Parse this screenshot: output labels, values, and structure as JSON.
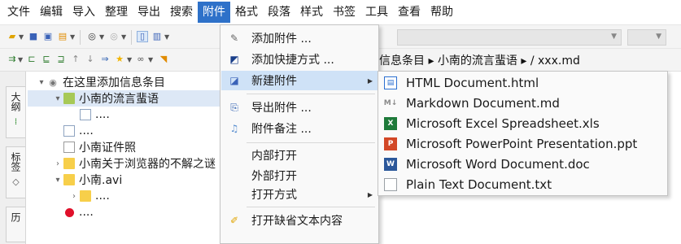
{
  "menubar": {
    "items": [
      "文件",
      "编辑",
      "导入",
      "整理",
      "导出",
      "搜索",
      "附件",
      "格式",
      "段落",
      "样式",
      "书签",
      "工具",
      "查看",
      "帮助"
    ],
    "active_index": 6
  },
  "breadcrumb": {
    "text": "信息条目  ▸  小南的流言蜚语  ▸  / xxx.md"
  },
  "side_tabs": [
    {
      "label": "大纲",
      "icon": "outline-icon"
    },
    {
      "label": "标签",
      "icon": "tag-icon"
    },
    {
      "label": "历",
      "icon": "history-icon"
    }
  ],
  "tree": {
    "rows": [
      {
        "indent": 0,
        "chevron": "▾",
        "icon": "eye-icon",
        "label": "在这里添加信息条目",
        "selected": false
      },
      {
        "indent": 1,
        "chevron": "▾",
        "icon": "folder-green-icon",
        "label": "小南的流言蜚语",
        "selected": true
      },
      {
        "indent": 2,
        "chevron": "",
        "icon": "doc-icon",
        "label": "....",
        "selected": false
      },
      {
        "indent": 1,
        "chevron": "",
        "icon": "doc-icon",
        "label": "....",
        "selected": false
      },
      {
        "indent": 1,
        "chevron": "",
        "icon": "doc-grey-icon",
        "label": "小南证件照",
        "selected": false
      },
      {
        "indent": 1,
        "chevron": "›",
        "icon": "folder-icon",
        "label": "小南关于浏览器的不解之谜",
        "selected": false
      },
      {
        "indent": 1,
        "chevron": "▾",
        "icon": "folder-icon",
        "label": "小南.avi",
        "selected": false
      },
      {
        "indent": 2,
        "chevron": "›",
        "icon": "folder-icon",
        "label": "....",
        "selected": false
      },
      {
        "indent": 1,
        "chevron": "",
        "icon": "red-bug-icon",
        "label": "....",
        "selected": false
      }
    ]
  },
  "attachment_menu": {
    "items": [
      {
        "icon": "paperclip-icon",
        "label": "添加附件 ...",
        "submenu": false
      },
      {
        "icon": "shortcut-icon",
        "label": "添加快捷方式 ...",
        "submenu": false
      },
      {
        "icon": "new-file-icon",
        "label": "新建附件",
        "submenu": true,
        "highlighted": true
      },
      {
        "icon": "export-icon",
        "label": "导出附件 ...",
        "submenu": false
      },
      {
        "icon": "note-icon",
        "label": "附件备注 ...",
        "submenu": false
      },
      {
        "icon": "",
        "label": "内部打开",
        "submenu": false
      },
      {
        "icon": "",
        "label": "外部打开",
        "submenu": false
      },
      {
        "icon": "",
        "label": "打开方式",
        "submenu": true
      },
      {
        "icon": "pencil-icon",
        "label": "打开缺省文本内容",
        "submenu": false
      }
    ]
  },
  "new_attachment_submenu": {
    "items": [
      {
        "icon": "html-icon",
        "label": "HTML Document.html",
        "color": "#2b6fd1"
      },
      {
        "icon": "markdown-icon",
        "label": "Markdown Document.md",
        "color": "#8a8a8a"
      },
      {
        "icon": "excel-icon",
        "label": "Microsoft Excel Spreadsheet.xls",
        "color": "#1e7a3a"
      },
      {
        "icon": "powerpoint-icon",
        "label": "Microsoft PowerPoint Presentation.ppt",
        "color": "#d24726"
      },
      {
        "icon": "word-icon",
        "label": "Microsoft Word Document.doc",
        "color": "#2b579a"
      },
      {
        "icon": "text-file-icon",
        "label": "Plain Text Document.txt",
        "color": "#9aa0a6"
      }
    ]
  },
  "colors": {
    "menu_active": "#2e71c9",
    "menu_highlight": "#cfe2f7",
    "tree_selected": "#dde8f6"
  }
}
